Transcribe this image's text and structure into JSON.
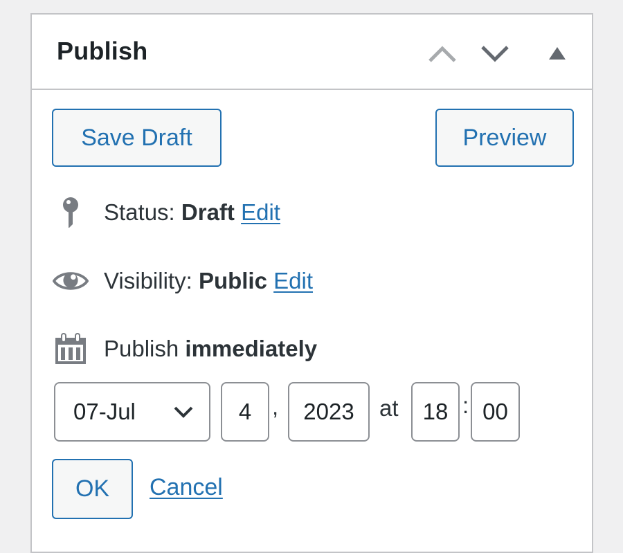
{
  "panel": {
    "title": "Publish",
    "header_controls": [
      "move-up",
      "move-down",
      "toggle-panel"
    ]
  },
  "actions": {
    "save_draft_label": "Save Draft",
    "preview_label": "Preview"
  },
  "status": {
    "label": "Status:",
    "value": "Draft",
    "edit_label": "Edit",
    "icon": "pin-icon"
  },
  "visibility": {
    "label": "Visibility:",
    "value": "Public",
    "edit_label": "Edit",
    "icon": "eye-icon"
  },
  "schedule": {
    "label": "Publish",
    "value": "immediately",
    "icon": "calendar-icon",
    "month": "07-Jul",
    "day": "4",
    "comma": ",",
    "year": "2023",
    "at_label": "at",
    "hour": "18",
    "colon": ":",
    "minute": "00",
    "ok_label": "OK",
    "cancel_label": "Cancel"
  },
  "colors": {
    "accent": "#2271b1",
    "border": "#c3c4c7",
    "icon": "#787c82",
    "background": "#f0f0f1"
  }
}
